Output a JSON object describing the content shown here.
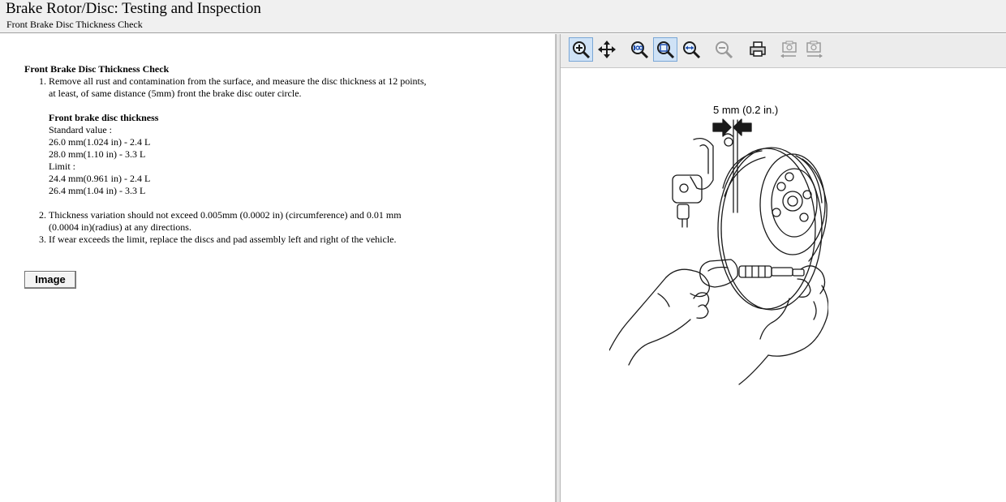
{
  "header": {
    "title": "Brake Rotor/Disc:  Testing and Inspection",
    "subtitle": "Front Brake Disc Thickness Check"
  },
  "content": {
    "section_title": "Front Brake Disc Thickness Check",
    "step1": "Remove all rust and contamination from the surface, and measure the disc thickness at 12 points, at least, of same distance (5mm) front the brake disc outer circle.",
    "spec": {
      "heading": "Front brake disc thickness",
      "standard_label": "Standard value :",
      "standard_1": "26.0 mm(1.024 in) - 2.4 L",
      "standard_2": "28.0 mm(1.10 in) - 3.3 L",
      "limit_label": "Limit :",
      "limit_1": "24.4 mm(0.961 in) - 2.4 L",
      "limit_2": "26.4 mm(1.04 in) - 3.3 L"
    },
    "step2": "Thickness variation should not exceed 0.005mm (0.0002 in) (circumference) and 0.01 mm (0.0004 in)(radius) at any directions.",
    "step3": "If wear exceeds the limit, replace the discs and pad assembly left and right of the vehicle.",
    "image_button": "Image"
  },
  "toolbar": {
    "buttons": [
      {
        "icon": "zoom-in-icon",
        "active": true
      },
      {
        "icon": "pan-icon",
        "active": false
      },
      {
        "icon": "zoom-100-icon",
        "active": false
      },
      {
        "icon": "fit-page-icon",
        "active": true
      },
      {
        "icon": "fit-width-icon",
        "active": false
      },
      {
        "icon": "zoom-out-icon",
        "active": false,
        "disabled": true
      },
      {
        "icon": "print-icon",
        "active": false
      },
      {
        "icon": "previous-view-icon",
        "active": false,
        "disabled": true
      },
      {
        "icon": "next-view-icon",
        "active": false,
        "disabled": true
      }
    ]
  },
  "figure": {
    "dimension_label": "5 mm (0.2 in.)"
  },
  "colors": {
    "header_bg": "#f0f0f0",
    "toolbar_bg": "#ececec",
    "active_button_bg": "#cfe2f6"
  }
}
